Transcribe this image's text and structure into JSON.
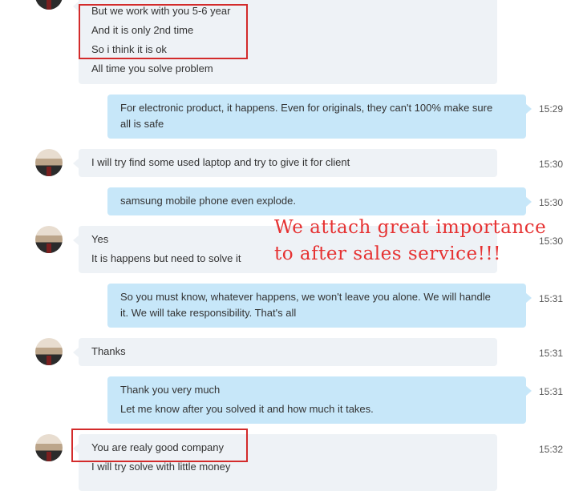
{
  "messages": [
    {
      "from": "client",
      "lines": [
        "But we work with you 5-6 year",
        "And it is only 2nd time",
        "So i think it is ok",
        "All time you solve problem"
      ],
      "time": ""
    },
    {
      "from": "me",
      "lines": [
        "For electronic product, it happens. Even for originals, they can't 100% make sure",
        "all is safe"
      ],
      "time": "15:29"
    },
    {
      "from": "client",
      "lines": [
        "I will try find some used laptop and try to give it for client"
      ],
      "time": "15:30"
    },
    {
      "from": "me",
      "lines": [
        "samsung mobile phone even explode."
      ],
      "time": "15:30"
    },
    {
      "from": "client",
      "lines": [
        "Yes",
        "It is happens but need to solve it"
      ],
      "time": "15:30"
    },
    {
      "from": "me",
      "lines": [
        "So you must know, whatever happens, we won't leave you alone. We will handle",
        "it. We will take responsibility. That's all"
      ],
      "time": "15:31"
    },
    {
      "from": "client",
      "lines": [
        "Thanks"
      ],
      "time": "15:31"
    },
    {
      "from": "me",
      "lines": [
        "Thank you very much",
        "Let me know after you solved it and how much it takes."
      ],
      "time": "15:31"
    },
    {
      "from": "client",
      "lines": [
        "You are realy good company",
        "I will try solve with little money"
      ],
      "time": "15:32"
    }
  ],
  "overlay": {
    "line1": "We attach great importance",
    "line2": "to after sales service!!!",
    "color": "#e63232"
  },
  "highlight_color": "#d32b2b"
}
